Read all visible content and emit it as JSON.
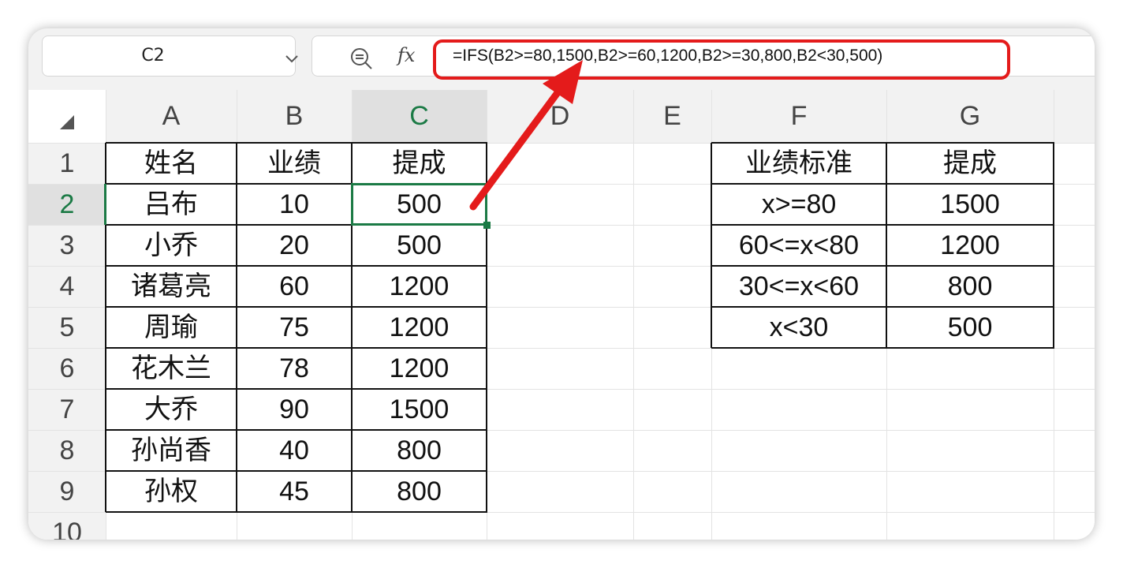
{
  "name_box": {
    "reference": "C2"
  },
  "formula_bar": {
    "fx_label": "fx",
    "formula": "=IFS(B2>=80,1500,B2>=60,1200,B2>=30,800,B2<30,500)"
  },
  "columns": [
    "A",
    "B",
    "C",
    "D",
    "E",
    "F",
    "G"
  ],
  "rows": [
    "1",
    "2",
    "3",
    "4",
    "5",
    "6",
    "7",
    "8",
    "9",
    "10"
  ],
  "selected_cell": "C2",
  "table_main": {
    "headers": [
      "姓名",
      "业绩",
      "提成"
    ],
    "rows": [
      [
        "吕布",
        "10",
        "500"
      ],
      [
        "小乔",
        "20",
        "500"
      ],
      [
        "诸葛亮",
        "60",
        "1200"
      ],
      [
        "周瑜",
        "75",
        "1200"
      ],
      [
        "花木兰",
        "78",
        "1200"
      ],
      [
        "大乔",
        "90",
        "1500"
      ],
      [
        "孙尚香",
        "40",
        "800"
      ],
      [
        "孙权",
        "45",
        "800"
      ]
    ]
  },
  "table_criteria": {
    "headers": [
      "业绩标准",
      "提成"
    ],
    "rows": [
      [
        "x>=80",
        "1500"
      ],
      [
        "60<=x<80",
        "1200"
      ],
      [
        "30<=x<60",
        "800"
      ],
      [
        "x<30",
        "500"
      ]
    ]
  },
  "colors": {
    "selection": "#1b7a45",
    "annotation": "#e41b1b"
  },
  "icons": [
    "zoom-out-icon",
    "chevron-down-icon",
    "select-all-icon",
    "annotation-arrow"
  ]
}
